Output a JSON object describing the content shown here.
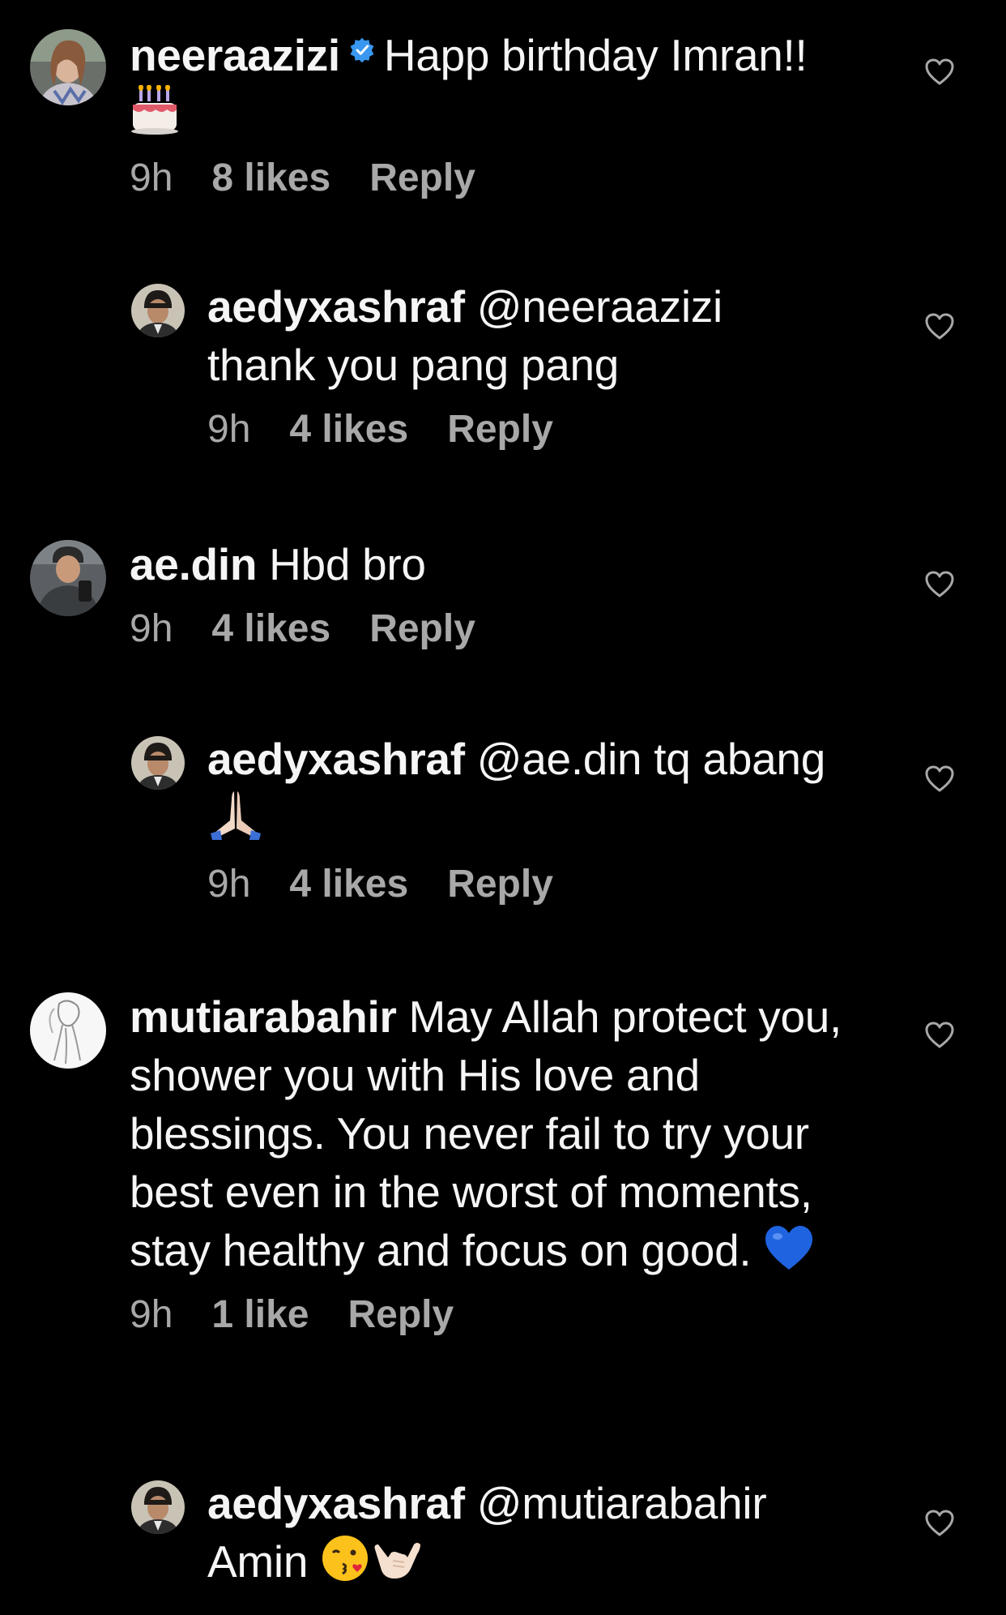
{
  "colors": {
    "background": "#000000",
    "text_primary": "#f5f5f5",
    "text_secondary": "#a8a8a8",
    "verified_badge": "#3897f0"
  },
  "comments": [
    {
      "username": "neeraazizi",
      "verified": true,
      "text": "Happ birthday Imran!!",
      "emoji": "birthday-cake-emoji",
      "time": "9h",
      "likes": "8 likes",
      "reply_label": "Reply"
    },
    {
      "username": "aedyxashraf",
      "mention": "@neeraazizi",
      "text": "thank you pang pang",
      "time": "9h",
      "likes": "4 likes",
      "reply_label": "Reply"
    },
    {
      "username": "ae.din",
      "text": "Hbd bro",
      "time": "9h",
      "likes": "4 likes",
      "reply_label": "Reply"
    },
    {
      "username": "aedyxashraf",
      "mention": "@ae.din",
      "text": "tq abang",
      "emoji": "folded-hands-emoji",
      "time": "9h",
      "likes": "4 likes",
      "reply_label": "Reply"
    },
    {
      "username": "mutiarabahir",
      "text": "May Allah protect you, shower you with His love and blessings. You never fail to try your best even in the worst of moments, stay healthy and focus on good.",
      "emoji": "blue-heart-emoji",
      "time": "9h",
      "likes": "1 like",
      "reply_label": "Reply"
    },
    {
      "username": "aedyxashraf",
      "mention": "@mutiarabahir",
      "text": "Amin",
      "emoji": [
        "kissing-face-emoji",
        "call-me-hand-emoji"
      ]
    }
  ]
}
